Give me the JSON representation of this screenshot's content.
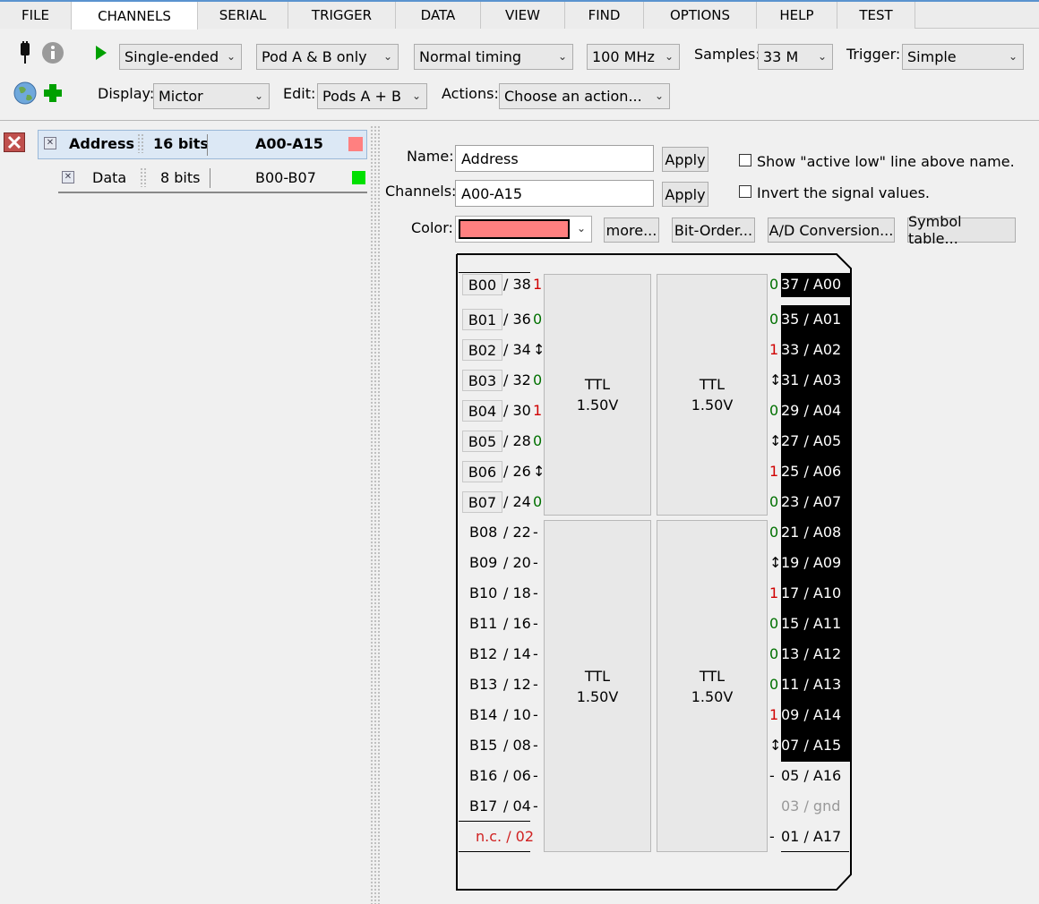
{
  "tabs": [
    "FILE",
    "CHANNELS",
    "SERIAL",
    "TRIGGER",
    "DATA",
    "VIEW",
    "FIND",
    "OPTIONS",
    "HELP",
    "TEST"
  ],
  "toolbar": {
    "mode": "Single-ended",
    "pods": "Pod A & B only",
    "timing": "Normal timing",
    "rate": "100 MHz",
    "samples_label": "Samples:",
    "samples": "33 M",
    "trigger_label": "Trigger:",
    "trigger": "Simple",
    "display_label": "Display:",
    "display": "Mictor",
    "edit_label": "Edit:",
    "edit": "Pods A + B",
    "actions_label": "Actions:",
    "actions": "Choose an action..."
  },
  "groups": [
    {
      "name": "Address",
      "bits": "16 bits",
      "range": "A00-A15",
      "color": "#ff8080"
    },
    {
      "name": "Data",
      "bits": "8 bits",
      "range": "B00-B07",
      "color": "#00e000"
    }
  ],
  "form": {
    "name_label": "Name:",
    "name_value": "Address",
    "channels_label": "Channels:",
    "channels_value": "A00-A15",
    "apply": "Apply",
    "active_low": "Show \"active low\" line above name.",
    "invert": "Invert the signal values.",
    "color_label": "Color:",
    "color_value": "#ff8080",
    "more": "more...",
    "bit_order": "Bit-Order...",
    "ad": "A/D Conversion...",
    "symbol": "Symbol table..."
  },
  "pods": {
    "type": "TTL",
    "voltage": "1.50V"
  },
  "left_pins": [
    {
      "ch": "B00",
      "pin": "/ 38",
      "v": "1",
      "btn": true
    },
    {
      "ch": "B01",
      "pin": "/ 36",
      "v": "0",
      "btn": true
    },
    {
      "ch": "B02",
      "pin": "/ 34",
      "v": "↕",
      "btn": true
    },
    {
      "ch": "B03",
      "pin": "/ 32",
      "v": "0",
      "btn": true
    },
    {
      "ch": "B04",
      "pin": "/ 30",
      "v": "1",
      "btn": true
    },
    {
      "ch": "B05",
      "pin": "/ 28",
      "v": "0",
      "btn": true
    },
    {
      "ch": "B06",
      "pin": "/ 26",
      "v": "↕",
      "btn": true
    },
    {
      "ch": "B07",
      "pin": "/ 24",
      "v": "0",
      "btn": true
    },
    {
      "ch": "B08",
      "pin": "/ 22",
      "v": "-",
      "btn": false
    },
    {
      "ch": "B09",
      "pin": "/ 20",
      "v": "-",
      "btn": false
    },
    {
      "ch": "B10",
      "pin": "/ 18",
      "v": "-",
      "btn": false
    },
    {
      "ch": "B11",
      "pin": "/ 16",
      "v": "-",
      "btn": false
    },
    {
      "ch": "B12",
      "pin": "/ 14",
      "v": "-",
      "btn": false
    },
    {
      "ch": "B13",
      "pin": "/ 12",
      "v": "-",
      "btn": false
    },
    {
      "ch": "B14",
      "pin": "/ 10",
      "v": "-",
      "btn": false
    },
    {
      "ch": "B15",
      "pin": "/ 08",
      "v": "-",
      "btn": false
    },
    {
      "ch": "B16",
      "pin": "/ 06",
      "v": "-",
      "btn": false
    },
    {
      "ch": "B17",
      "pin": "/ 04",
      "v": "-",
      "btn": false
    },
    {
      "ch": "n.c. / 02",
      "pin": "",
      "v": "",
      "btn": false
    }
  ],
  "right_pins": [
    {
      "v": "0",
      "label": "37 / A00",
      "sel": true
    },
    {
      "v": "0",
      "label": "35 / A01",
      "sel": true
    },
    {
      "v": "1",
      "label": "33 / A02",
      "sel": true
    },
    {
      "v": "↕",
      "label": "31 / A03",
      "sel": true
    },
    {
      "v": "0",
      "label": "29 / A04",
      "sel": true
    },
    {
      "v": "↕",
      "label": "27 / A05",
      "sel": true
    },
    {
      "v": "1",
      "label": "25 / A06",
      "sel": true
    },
    {
      "v": "0",
      "label": "23 / A07",
      "sel": true
    },
    {
      "v": "0",
      "label": "21 / A08",
      "sel": true
    },
    {
      "v": "↕",
      "label": "19 / A09",
      "sel": true
    },
    {
      "v": "1",
      "label": "17 / A10",
      "sel": true
    },
    {
      "v": "0",
      "label": "15 / A11",
      "sel": true
    },
    {
      "v": "0",
      "label": "13 / A12",
      "sel": true
    },
    {
      "v": "0",
      "label": "11 / A13",
      "sel": true
    },
    {
      "v": "1",
      "label": "09 / A14",
      "sel": true
    },
    {
      "v": "↕",
      "label": "07 / A15",
      "sel": true
    },
    {
      "v": "-",
      "label": "05 / A16",
      "sel": false
    },
    {
      "v": "",
      "label": "03 / gnd",
      "sel": false
    },
    {
      "v": "-",
      "label": "01 / A17",
      "sel": false
    }
  ]
}
